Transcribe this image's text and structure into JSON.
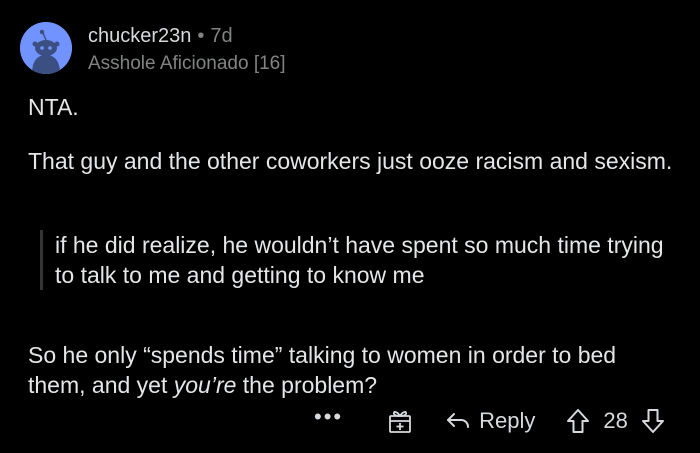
{
  "comment": {
    "author": "chucker23n",
    "separator": "•",
    "age": "7d",
    "flair": "Asshole Aficionado [16]",
    "paragraphs": {
      "p1": "NTA.",
      "p2": "That guy and the other coworkers just ooze racism and sexism.",
      "quote": "if he did realize, he wouldn’t have spent so much time trying to talk to me and getting to know me",
      "p3_start": "So he only “spends time” talking to women in order to bed them, and yet ",
      "p3_emphasis": "you’re",
      "p3_end": " the problem?"
    }
  },
  "actions": {
    "more_label": "•••",
    "reply_label": "Reply",
    "score": "28"
  },
  "icons": {
    "avatar": "snoo-avatar-icon",
    "more": "more-options-icon",
    "gift": "gift-award-icon",
    "reply": "reply-arrow-icon",
    "upvote": "upvote-arrow-icon",
    "downvote": "downvote-arrow-icon"
  },
  "colors": {
    "background": "#000000",
    "text": "#D7DADC",
    "muted": "#818384",
    "avatar_bg": "#7193FF",
    "quote_bar": "#343536"
  }
}
